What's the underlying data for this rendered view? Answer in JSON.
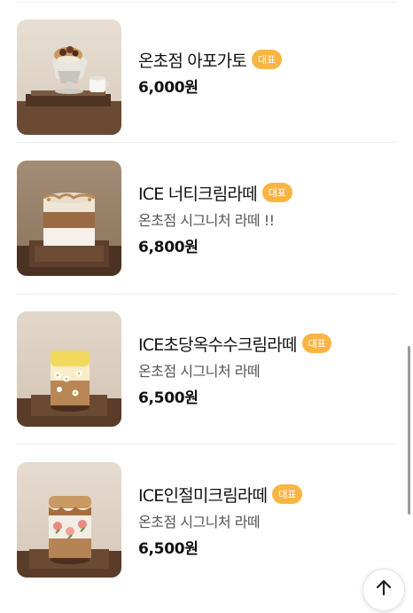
{
  "menu_items": [
    {
      "name": "온초점 아포가토",
      "badge": "대표",
      "description": "",
      "price": "6,000원",
      "image_icon": "affogato-photo"
    },
    {
      "name": "ICE 너티크림라떼",
      "badge": "대표",
      "description": "온초점 시그니처 라떼 !!",
      "price": "6,800원",
      "image_icon": "nutty-cream-latte-photo"
    },
    {
      "name": "ICE초당옥수수크림라떼",
      "badge": "대표",
      "description": "온초점 시그니처 라떼",
      "price": "6,500원",
      "image_icon": "corn-cream-latte-photo"
    },
    {
      "name": "ICE인절미크림라떼",
      "badge": "대표",
      "description": "온초점 시그니처 라떼",
      "price": "6,500원",
      "image_icon": "injeolmi-cream-latte-photo"
    }
  ],
  "colors": {
    "badge_bg": "#f8b544",
    "badge_text": "#ffffff",
    "divider": "#ededed"
  },
  "scroll_top_icon": "arrow-up-icon"
}
